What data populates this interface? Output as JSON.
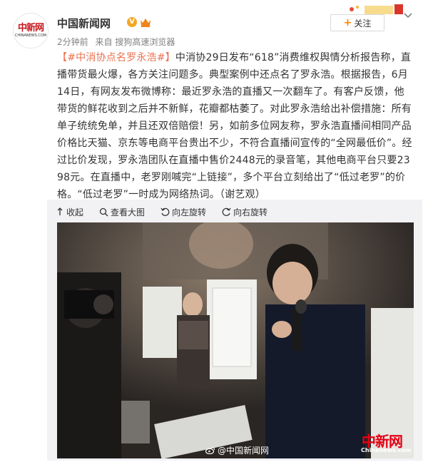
{
  "user": {
    "name": "中国新闻网",
    "avatar_text": "中新网",
    "avatar_sub": "CHINANEWS.COM"
  },
  "meta": {
    "time": "2分钟前",
    "source_prefix": "来自",
    "source": "搜狗高速浏览器"
  },
  "follow_label": "关注",
  "post": {
    "topic": "【#中消协点名罗永浩#】",
    "text": "中消协29日发布“618”消费维权舆情分析报告称，直播带货最火爆，各方关注问题多。典型案例中还点名了罗永浩。根据报告，6月14日，有网友发布微博称：最近罗永浩的直播又一次翻车了。有客户反馈，他带货的鲜花收到之后并不新鲜，花瓣都枯萎了。对此罗永浩给出补偿措施：所有单子统统免单，并且还双倍赔偿！另，如前多位网友称，罗永浩直播间相同产品价格比天猫、京东等电商平台贵出不少，不符合直播间宣传的“全网最低价”。经过比价发现，罗永浩团队在直播中售价2448元的录音笔，其他电商平台只要2398元。在直播中，老罗刚喊完“上链接”，多个平台立刻给出了“低过老罗”的价格。“低过老罗”一时成为网络热词。（谢艺观）"
  },
  "media_tools": {
    "collapse": "收起",
    "view_large": "查看大图",
    "rotate_left": "向左旋转",
    "rotate_right": "向右旋转"
  },
  "photo": {
    "watermark_cn": "中新网",
    "watermark_en": "Chinanews.com",
    "weibo_watermark": "@中国新闻网"
  },
  "colors": {
    "topic": "#eb7350",
    "follow_plus": "#ff8200",
    "meta_gray": "#808080",
    "watermark_red": "#e60012"
  }
}
